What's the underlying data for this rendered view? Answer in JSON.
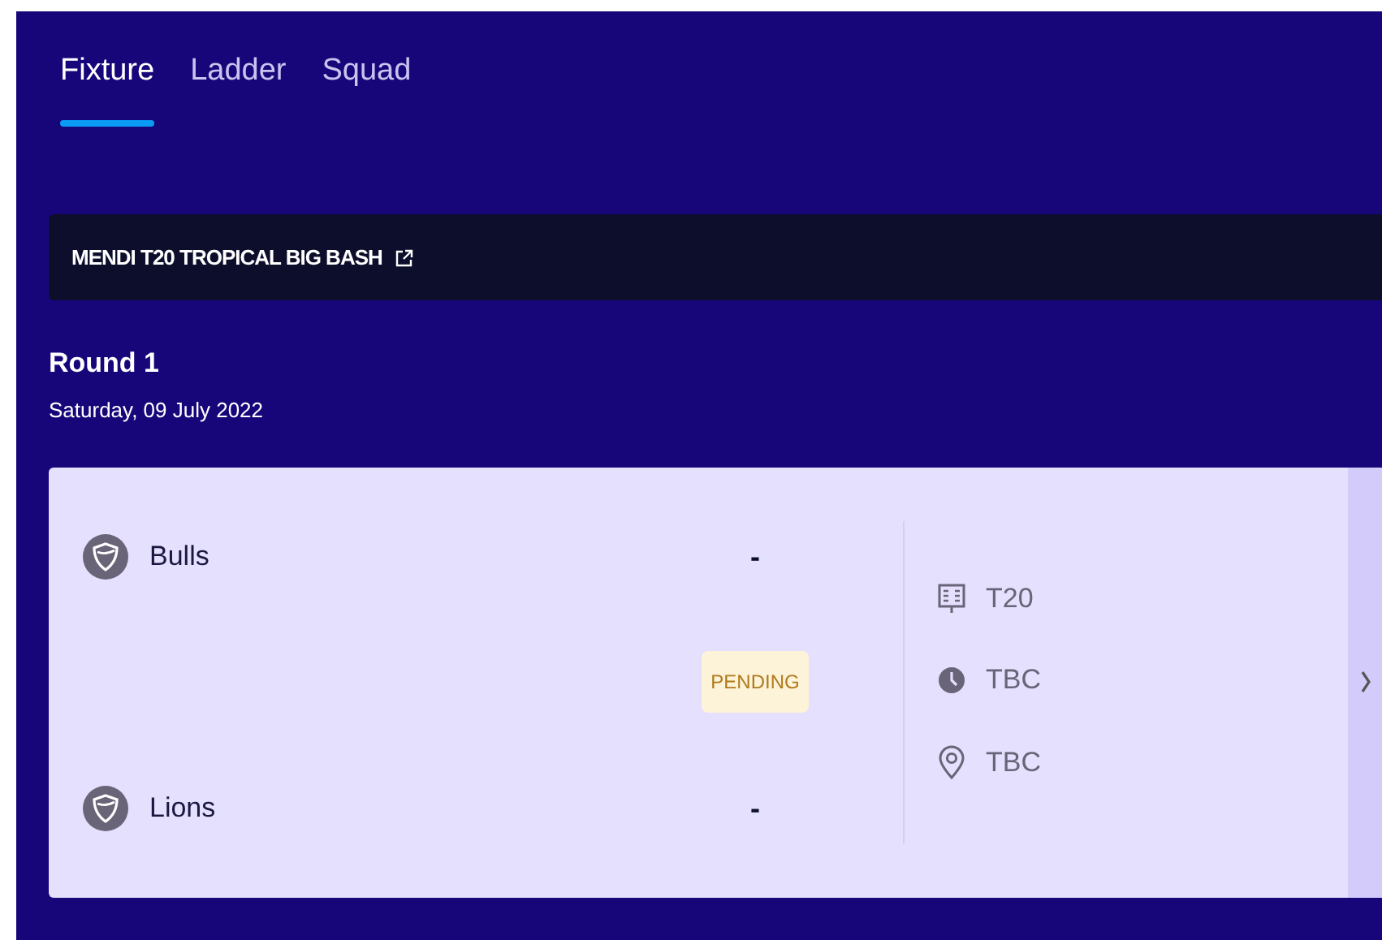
{
  "tabs": [
    {
      "label": "Fixture",
      "selected": true
    },
    {
      "label": "Ladder",
      "selected": false
    },
    {
      "label": "Squad",
      "selected": false
    }
  ],
  "competition": {
    "title": "MENDI T20 TROPICAL BIG BASH"
  },
  "round": {
    "title": "Round 1",
    "date": "Saturday, 09 July 2022"
  },
  "match": {
    "teams": [
      {
        "name": "Bulls",
        "score": "-"
      },
      {
        "name": "Lions",
        "score": "-"
      }
    ],
    "status": "PENDING",
    "details": [
      {
        "kind": "format",
        "text": "T20"
      },
      {
        "kind": "time",
        "text": "TBC"
      },
      {
        "kind": "venue",
        "text": "TBC"
      }
    ]
  }
}
